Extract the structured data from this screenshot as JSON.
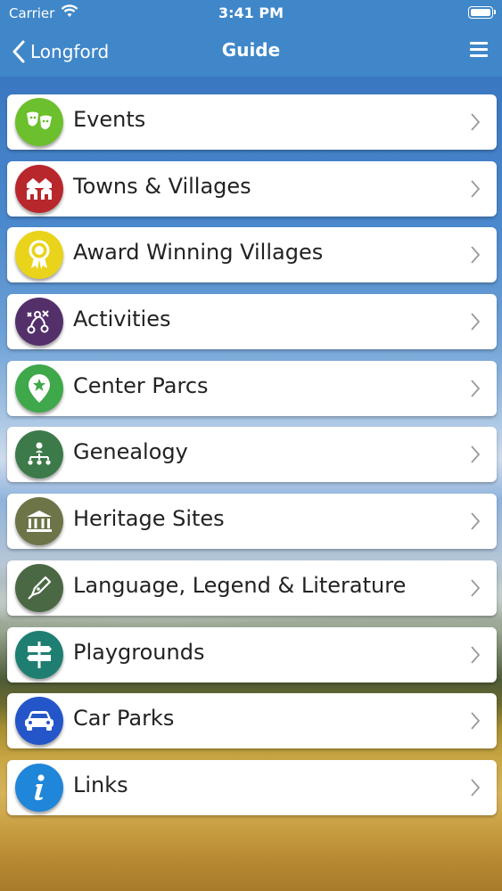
{
  "status_bar": {
    "carrier": "Carrier",
    "time": "3:41 PM"
  },
  "nav": {
    "back_label": "Longford",
    "title": "Guide"
  },
  "menu": [
    {
      "label": "Events",
      "icon": "theatre-masks-icon",
      "color": "#6cbf2d"
    },
    {
      "label": "Towns & Villages",
      "icon": "houses-icon",
      "color": "#b8272c"
    },
    {
      "label": "Award Winning Villages",
      "icon": "award-rosette-icon",
      "color": "#e9d31b"
    },
    {
      "label": "Activities",
      "icon": "activities-icon",
      "color": "#54306b"
    },
    {
      "label": "Center Parcs",
      "icon": "map-pin-star-icon",
      "color": "#3fa84a"
    },
    {
      "label": "Genealogy",
      "icon": "family-tree-icon",
      "color": "#3c7a49"
    },
    {
      "label": "Heritage Sites",
      "icon": "heritage-building-icon",
      "color": "#6d7447"
    },
    {
      "label": "Language, Legend & Literature",
      "icon": "pen-nib-icon",
      "color": "#4a6843"
    },
    {
      "label": "Playgrounds",
      "icon": "signpost-icon",
      "color": "#1f7e72"
    },
    {
      "label": "Car Parks",
      "icon": "car-icon",
      "color": "#2456c9"
    },
    {
      "label": "Links",
      "icon": "info-icon",
      "color": "#1f86d9"
    }
  ]
}
